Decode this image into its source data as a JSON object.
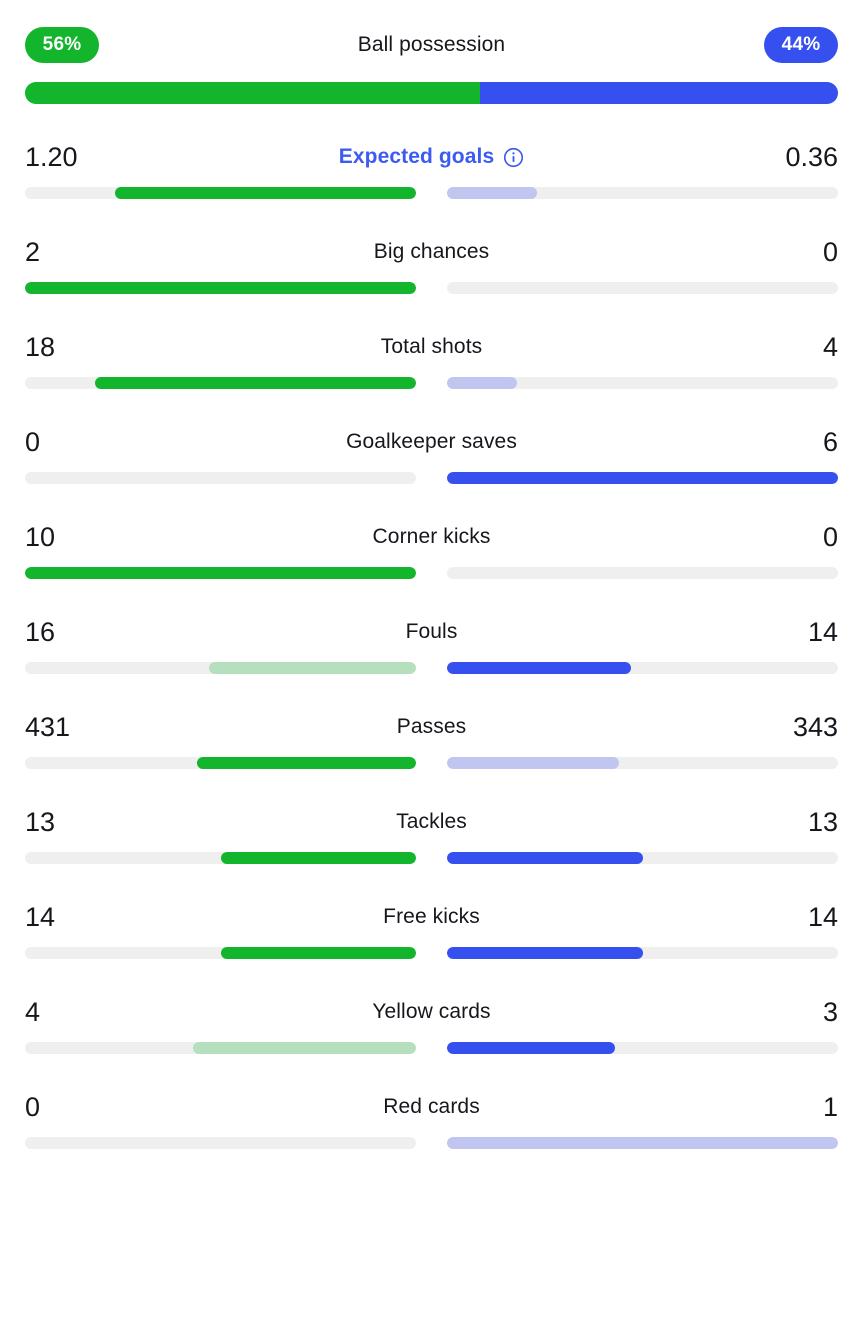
{
  "colors": {
    "home_strong": "#13b52c",
    "home_pale": "#b6dfbe",
    "away_strong": "#3550ee",
    "away_pale": "#c0c6f0",
    "track": "#efefef",
    "link": "#3e5bf0",
    "text": "#16171c"
  },
  "possession": {
    "label": "Ball possession",
    "home": "56%",
    "away": "44%",
    "home_pct": 56,
    "away_pct": 44
  },
  "rows": [
    {
      "label": "Expected goals",
      "home": "1.20",
      "away": "0.36",
      "home_pct": 77,
      "away_pct": 23,
      "home_tone": "green",
      "away_tone": "blue-pale",
      "is_link": true,
      "has_info": true
    },
    {
      "label": "Big chances",
      "home": "2",
      "away": "0",
      "home_pct": 100,
      "away_pct": 0,
      "home_tone": "green",
      "away_tone": "none",
      "is_link": false,
      "has_info": false
    },
    {
      "label": "Total shots",
      "home": "18",
      "away": "4",
      "home_pct": 82,
      "away_pct": 18,
      "home_tone": "green",
      "away_tone": "blue-pale",
      "is_link": false,
      "has_info": false
    },
    {
      "label": "Goalkeeper saves",
      "home": "0",
      "away": "6",
      "home_pct": 0,
      "away_pct": 100,
      "home_tone": "none",
      "away_tone": "blue",
      "is_link": false,
      "has_info": false
    },
    {
      "label": "Corner kicks",
      "home": "10",
      "away": "0",
      "home_pct": 100,
      "away_pct": 0,
      "home_tone": "green",
      "away_tone": "none",
      "is_link": false,
      "has_info": false
    },
    {
      "label": "Fouls",
      "home": "16",
      "away": "14",
      "home_pct": 53,
      "away_pct": 47,
      "home_tone": "green-pale",
      "away_tone": "blue",
      "is_link": false,
      "has_info": false
    },
    {
      "label": "Passes",
      "home": "431",
      "away": "343",
      "home_pct": 56,
      "away_pct": 44,
      "home_tone": "green",
      "away_tone": "blue-pale",
      "is_link": false,
      "has_info": false
    },
    {
      "label": "Tackles",
      "home": "13",
      "away": "13",
      "home_pct": 50,
      "away_pct": 50,
      "home_tone": "green",
      "away_tone": "blue",
      "is_link": false,
      "has_info": false
    },
    {
      "label": "Free kicks",
      "home": "14",
      "away": "14",
      "home_pct": 50,
      "away_pct": 50,
      "home_tone": "green",
      "away_tone": "blue",
      "is_link": false,
      "has_info": false
    },
    {
      "label": "Yellow cards",
      "home": "4",
      "away": "3",
      "home_pct": 57,
      "away_pct": 43,
      "home_tone": "green-pale",
      "away_tone": "blue",
      "is_link": false,
      "has_info": false
    },
    {
      "label": "Red cards",
      "home": "0",
      "away": "1",
      "home_pct": 0,
      "away_pct": 100,
      "home_tone": "none",
      "away_tone": "blue-pale",
      "is_link": false,
      "has_info": false
    }
  ],
  "icons": {
    "info": "info-icon"
  }
}
